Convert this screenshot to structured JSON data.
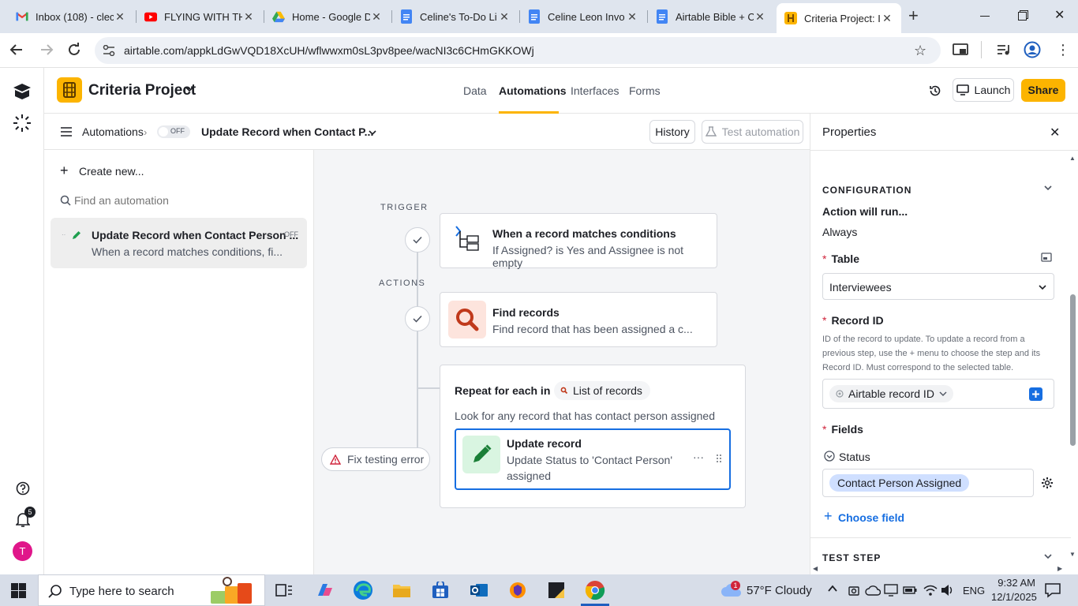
{
  "browser": {
    "tabs": [
      {
        "title": "Inbox (108) - clec",
        "icon": "gmail-icon"
      },
      {
        "title": "FLYING WITH TH",
        "icon": "youtube-icon"
      },
      {
        "title": "Home - Google D",
        "icon": "google-drive-icon"
      },
      {
        "title": "Celine's To-Do Li",
        "icon": "google-docs-icon"
      },
      {
        "title": "Celine Leon Invo",
        "icon": "google-docs-icon"
      },
      {
        "title": "Airtable Bible + C",
        "icon": "google-docs-icon"
      },
      {
        "title": "Criteria Project: In",
        "icon": "airtable-icon",
        "active": true
      }
    ],
    "url": "airtable.com/appkLdGwVQD18XcUH/wflwwxm0sL3pv8pee/wacNI3c6CHmGKKOWj"
  },
  "app": {
    "base_name": "Criteria Project",
    "nav_tabs": [
      "Data",
      "Automations",
      "Interfaces",
      "Forms"
    ],
    "active_nav": "Automations",
    "launch_label": "Launch",
    "share_label": "Share",
    "notification_count": "5",
    "avatar_letter": "T"
  },
  "subheader": {
    "section": "Automations",
    "toggle_state": "OFF",
    "automation_name": "Update Record when Contact P...",
    "history_label": "History",
    "test_label": "Test automation"
  },
  "sidebar": {
    "create_label": "Create new...",
    "search_placeholder": "Find an automation",
    "items": [
      {
        "title": "Update Record when Contact Person ...",
        "subtitle": "When a record matches conditions, fi...",
        "state": "OFF"
      }
    ]
  },
  "canvas": {
    "trigger_label": "TRIGGER",
    "actions_label": "ACTIONS",
    "trigger": {
      "title": "When a record matches conditions",
      "desc": "If Assigned? is Yes and Assignee is not empty"
    },
    "find": {
      "title": "Find records",
      "desc": "Find record that has been assigned a c..."
    },
    "repeat": {
      "title": "Repeat for each in",
      "chip": "List of records",
      "desc": "Look for any record that has contact person assigned"
    },
    "update": {
      "title": "Update record",
      "desc_line1": "Update Status to 'Contact Person'",
      "desc_line2": "assigned"
    },
    "fix_label": "Fix testing error"
  },
  "properties": {
    "header": "Properties",
    "configuration_label": "CONFIGURATION",
    "action_runs_label": "Action will run...",
    "action_runs_value": "Always",
    "table_label": "Table",
    "table_value": "Interviewees",
    "record_id_label": "Record ID",
    "record_id_help_1": "ID of the record to update. To update a record from a",
    "record_id_help_2": "previous step, use the + menu to choose the step and its",
    "record_id_help_3": "Record ID. Must correspond to the selected table.",
    "record_id_token": "Airtable record ID",
    "fields_label": "Fields",
    "status_label": "Status",
    "status_value": "Contact Person Assigned",
    "choose_field_label": "Choose field",
    "test_step_label": "TEST STEP"
  },
  "taskbar": {
    "search_placeholder": "Type here to search",
    "weather": "57°F  Cloudy",
    "weather_badge": "1",
    "lang": "ENG",
    "time": "9:32 AM",
    "date": "12/1/2025"
  },
  "colors": {
    "accent_orange": "#fcb400",
    "automations_underline": "#fcb400",
    "update_border": "#166ee1",
    "required_red": "#d0243b",
    "status_chip": "#cfdfff"
  }
}
